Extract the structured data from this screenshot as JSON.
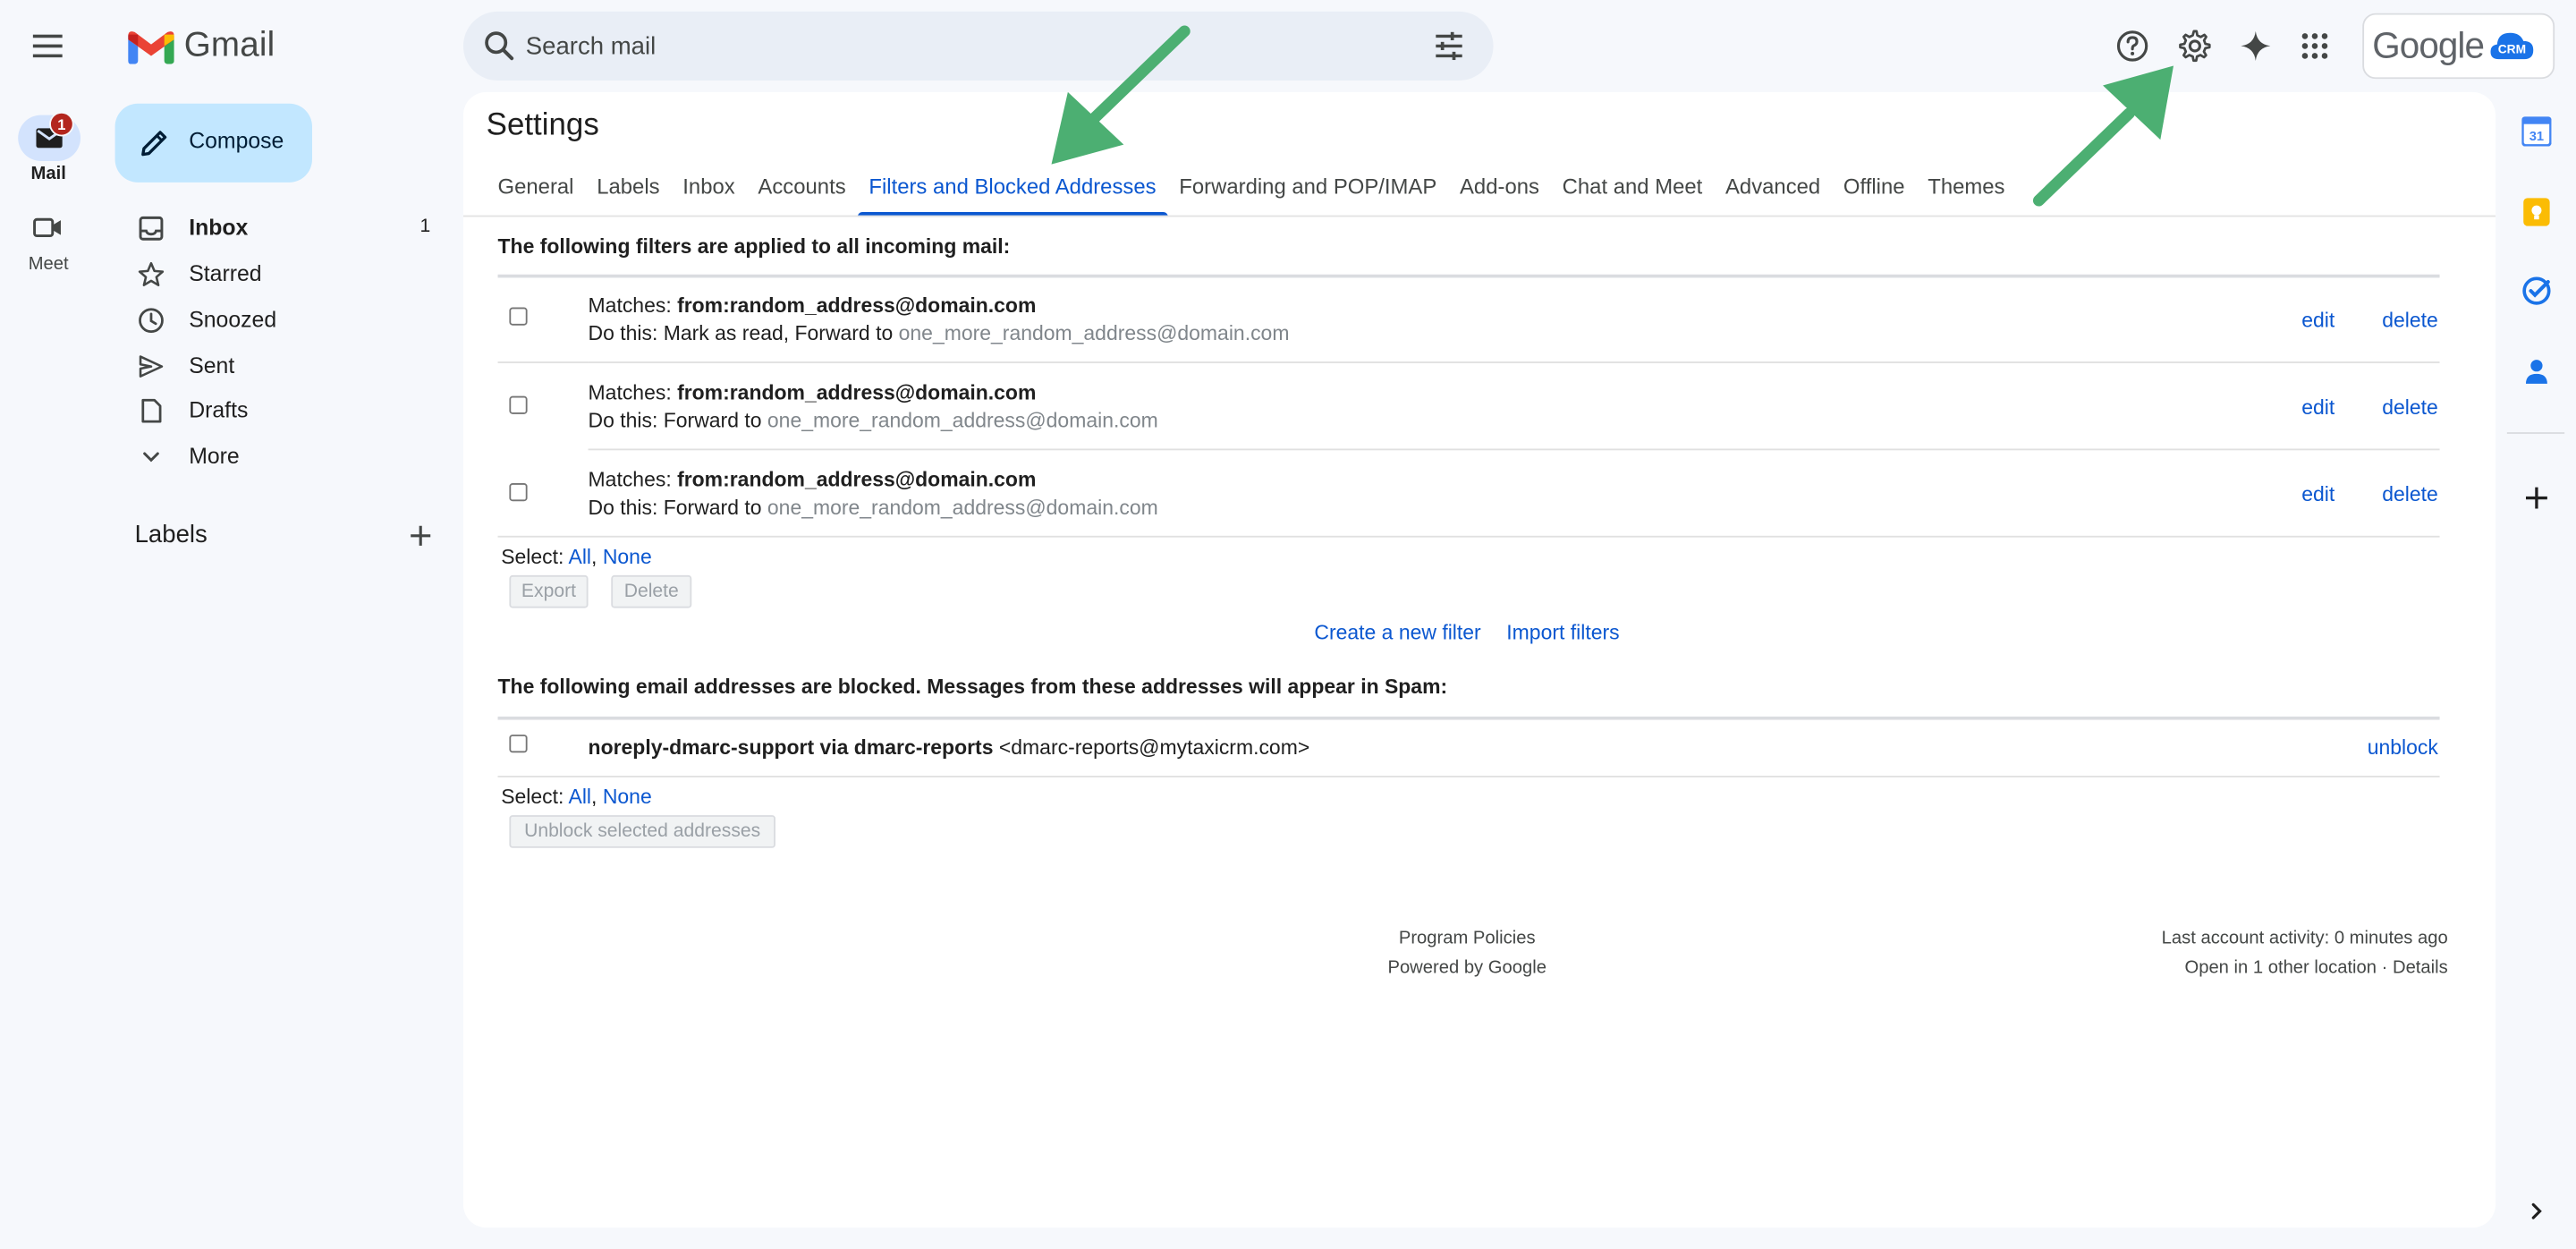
{
  "app": {
    "name": "Gmail"
  },
  "rail": {
    "mail_label": "Mail",
    "mail_badge": "1",
    "meet_label": "Meet"
  },
  "search": {
    "placeholder": "Search mail"
  },
  "account": {
    "brand": "Google",
    "badge_text": "CRM"
  },
  "compose_label": "Compose",
  "nav": {
    "items": [
      {
        "label": "Inbox",
        "count": "1",
        "icon": "inbox-icon",
        "bold": true
      },
      {
        "label": "Starred",
        "count": "",
        "icon": "star-icon"
      },
      {
        "label": "Snoozed",
        "count": "",
        "icon": "clock-icon"
      },
      {
        "label": "Sent",
        "count": "",
        "icon": "send-icon"
      },
      {
        "label": "Drafts",
        "count": "",
        "icon": "draft-icon"
      },
      {
        "label": "More",
        "count": "",
        "icon": "chevron-down-icon"
      }
    ],
    "labels_heading": "Labels"
  },
  "settings": {
    "title": "Settings",
    "tabs": [
      {
        "label": "General"
      },
      {
        "label": "Labels"
      },
      {
        "label": "Inbox"
      },
      {
        "label": "Accounts"
      },
      {
        "label": "Filters and Blocked Addresses",
        "active": true
      },
      {
        "label": "Forwarding and POP/IMAP"
      },
      {
        "label": "Add-ons"
      },
      {
        "label": "Chat and Meet"
      },
      {
        "label": "Advanced"
      },
      {
        "label": "Offline"
      },
      {
        "label": "Themes"
      }
    ],
    "filters_heading": "The following filters are applied to all incoming mail:",
    "filters": [
      {
        "matches_prefix": "Matches: ",
        "matches_value": "from:random_address@domain.com",
        "action_prefix": "Do this: Mark as read, Forward to",
        "forward_to": "one_more_random_address@domain.com",
        "edit": "edit",
        "delete": "delete"
      },
      {
        "matches_prefix": "Matches: ",
        "matches_value": "from:random_address@domain.com",
        "action_prefix": "Do this: Forward to",
        "forward_to": "one_more_random_address@domain.com",
        "edit": "edit",
        "delete": "delete"
      },
      {
        "matches_prefix": "Matches: ",
        "matches_value": "from:random_address@domain.com",
        "action_prefix": "Do this: Forward to",
        "forward_to": "one_more_random_address@domain.com",
        "edit": "edit",
        "delete": "delete"
      }
    ],
    "select_label": "Select: ",
    "select_all": "All",
    "select_sep": ", ",
    "select_none": "None",
    "export_label": "Export",
    "delete_label": "Delete",
    "create_filter": "Create a new filter",
    "import_filters": "Import filters",
    "blocked_heading": "The following email addresses are blocked. Messages from these addresses will appear in Spam:",
    "blocked": [
      {
        "name": "noreply-dmarc-support via dmarc-reports",
        "email": "<dmarc-reports@mytaxicrm.com>",
        "unblock": "unblock"
      }
    ],
    "unblock_selected": "Unblock selected addresses"
  },
  "footer": {
    "program_policies": "Program Policies",
    "powered_by": "Powered by Google",
    "last_activity": "Last account activity: 0 minutes ago",
    "other_location": "Open in 1 other location · ",
    "details": "Details"
  },
  "side_panel": {
    "calendar_day": "31"
  },
  "colors": {
    "accent": "#0b57d0",
    "compose_bg": "#c2e7ff",
    "annotation_arrow": "#4caf72",
    "badge": "#b3261e"
  }
}
